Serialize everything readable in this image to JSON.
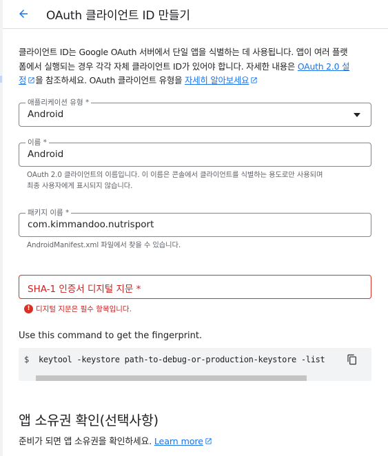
{
  "header": {
    "title": "OAuth 클라이언트 ID 만들기"
  },
  "intro": {
    "line1": "클라이언트 ID는 Google OAuth 서버에서 단일 앱을 식별하는 데 사용됩니다. 앱이 여러 플랫",
    "line2_a": "폼에서 실행되는 경우 각각 자체 클라이언트 ID가 있어야 합니다. 자세한 내용은 ",
    "link1_part1": "OAuth 2.0 설",
    "link1_part2": "정",
    "line3_a": "을 참조하세요. OAuth 클라이언트 유형을 ",
    "link2": "자세히 알아보세요"
  },
  "form": {
    "app_type": {
      "label": "애플리케이션 유형 *",
      "value": "Android"
    },
    "name": {
      "label": "이름 *",
      "value": "Android",
      "hint_line1": "OAuth 2.0 클라이언트의 이름입니다. 이 이름은 콘솔에서 클라이언트를 식별하는 용도로만 사용되며",
      "hint_line2": "최종 사용자에게 표시되지 않습니다."
    },
    "package": {
      "label": "패키지 이름 *",
      "value": "com.kimmandoo.nutrisport",
      "hint": "AndroidManifest.xml 파일에서 찾을 수 있습니다."
    },
    "sha1": {
      "placeholder": "SHA-1 인증서 디지털 지문 *",
      "error": "디지털 지문은 필수 항목입니다."
    }
  },
  "command": {
    "caption": "Use this command to get the fingerprint.",
    "prompt": "$",
    "text": "keytool -keystore path-to-debug-or-production-keystore -list"
  },
  "ownership": {
    "title": "앱 소유권 확인(선택사항)",
    "desc": "준비가 되면 앱 소유권을 확인하세요. ",
    "link": "Learn more"
  },
  "colors": {
    "accent": "#1a73e8",
    "error": "#d93025",
    "border": "#80868b",
    "code_bg": "#f1f3f4"
  },
  "icons": {
    "back": "arrow-left-icon",
    "external": "open-in-new-icon",
    "dropdown": "caret-down-icon",
    "error": "error-circle-icon",
    "copy": "content-copy-icon"
  }
}
